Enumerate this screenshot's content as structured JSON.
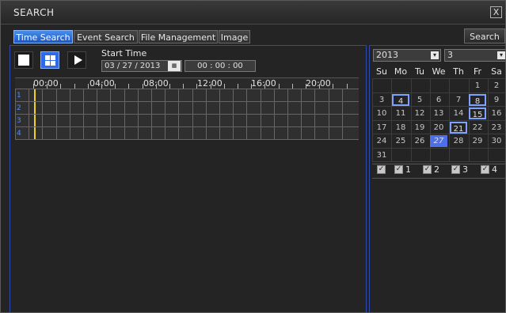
{
  "window": {
    "title": "SEARCH",
    "close_glyph": "X"
  },
  "tabs": [
    {
      "label": "Time Search",
      "active": true
    },
    {
      "label": "Event Search",
      "active": false
    },
    {
      "label": "File Management",
      "active": false
    },
    {
      "label": "Image",
      "active": false
    }
  ],
  "search_button": "Search",
  "controls": {
    "stop_icon": "stop-icon",
    "multi_view_icon": "quad-view-icon",
    "play_icon": "play-icon"
  },
  "start_time": {
    "label": "Start Time",
    "date": "03 / 27 / 2013",
    "time": "00 : 00 : 00",
    "calendar_icon_glyph": "▦"
  },
  "timeline": {
    "hours": [
      "00:00",
      "04:00",
      "08:00",
      "12:00",
      "16:00",
      "20:00"
    ],
    "channels": [
      "1",
      "2",
      "3",
      "4"
    ]
  },
  "calendar": {
    "year": "2013",
    "month": "3",
    "dropdown_glyph": "▾",
    "weekdays": [
      "Su",
      "Mo",
      "Tu",
      "We",
      "Th",
      "Fr",
      "Sa"
    ],
    "weeks": [
      [
        "",
        "",
        "",
        "",
        "",
        "1",
        "2"
      ],
      [
        "3",
        "4",
        "5",
        "6",
        "7",
        "8",
        "9"
      ],
      [
        "10",
        "11",
        "12",
        "13",
        "14",
        "15",
        "16"
      ],
      [
        "17",
        "18",
        "19",
        "20",
        "21",
        "22",
        "23"
      ],
      [
        "24",
        "25",
        "26",
        "27",
        "28",
        "29",
        "30"
      ],
      [
        "31",
        "",
        "",
        "",
        "",
        "",
        ""
      ]
    ],
    "recorded_days": [
      "4",
      "8",
      "15",
      "21"
    ],
    "selected_day": "27",
    "colors": {
      "selected": "#4f6fe8",
      "recorded_border": "#7fa2ff"
    }
  },
  "channel_checks": {
    "check_glyph": "✓",
    "labels": [
      "",
      "1",
      "2",
      "3",
      "4"
    ]
  },
  "colors": {
    "active_tab": "#1a56c8",
    "timeline_cursor": "#f0d020",
    "channel_number": "#4d8cff"
  }
}
